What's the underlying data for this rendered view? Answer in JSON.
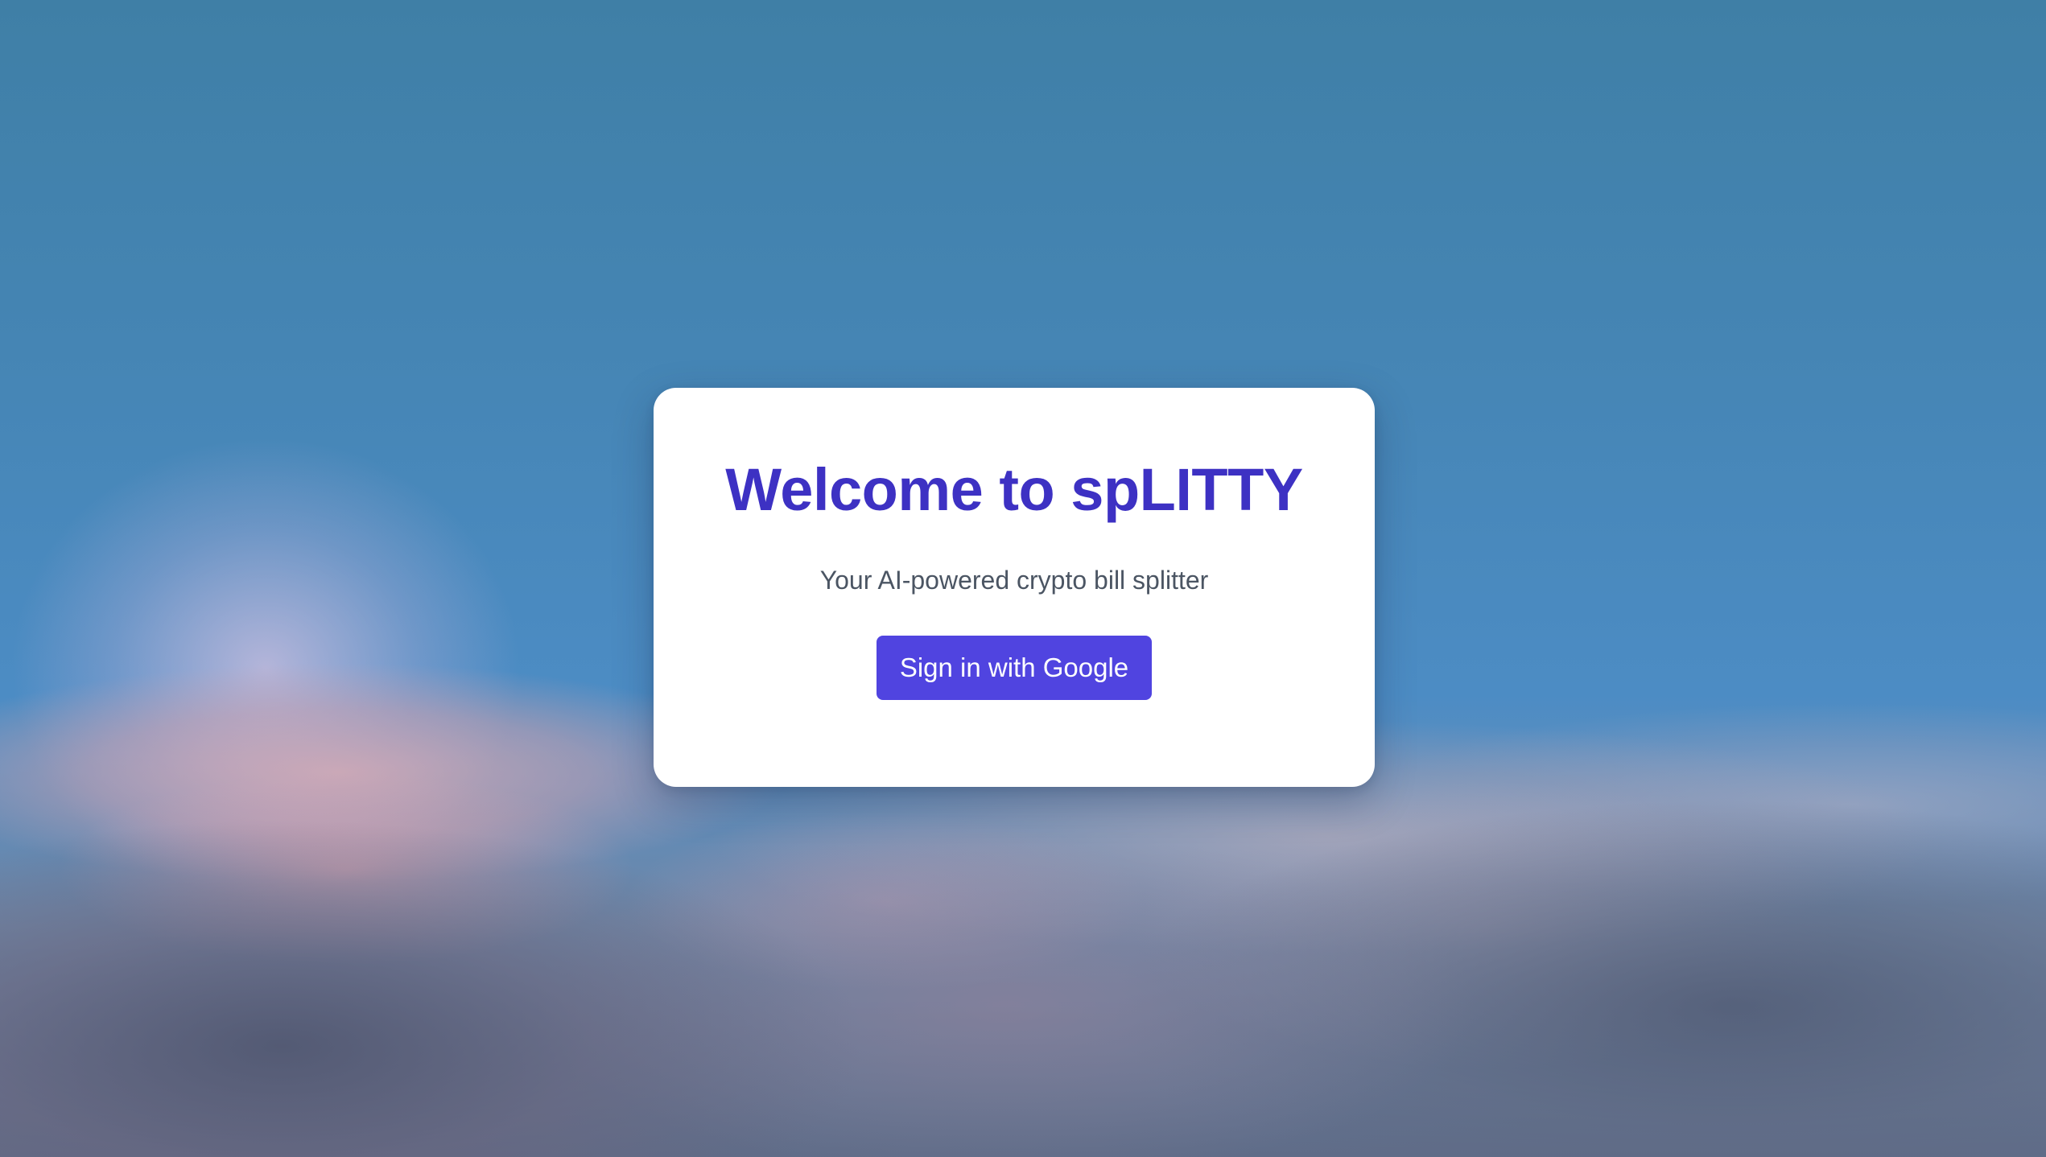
{
  "login": {
    "title": "Welcome to spLITTY",
    "subtitle": "Your AI-powered crypto bill splitter",
    "signin_label": "Sign in with Google"
  },
  "colors": {
    "title": "#3d31c3",
    "button_bg": "#5044e0",
    "button_text": "#ffffff",
    "subtitle": "#4b5563",
    "card_bg": "#ffffff"
  },
  "background": {
    "scene": "sky-with-clouds"
  }
}
